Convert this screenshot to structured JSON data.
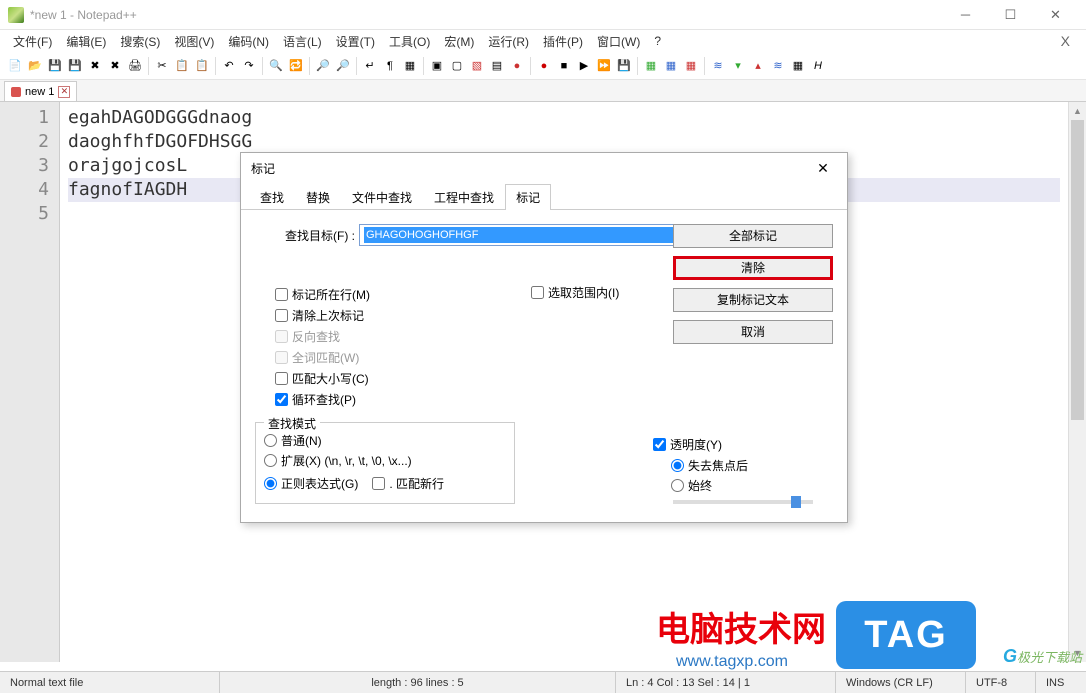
{
  "window": {
    "title": "*new 1 - Notepad++"
  },
  "menu": [
    "文件(F)",
    "编辑(E)",
    "搜索(S)",
    "视图(V)",
    "编码(N)",
    "语言(L)",
    "设置(T)",
    "工具(O)",
    "宏(M)",
    "运行(R)",
    "插件(P)",
    "窗口(W)",
    "?"
  ],
  "tab": {
    "name": "new 1"
  },
  "gutter": [
    "1",
    "2",
    "3",
    "4",
    "5"
  ],
  "code": {
    "l1": "egahDAGODGGGdnaog",
    "l2": "daoghfhfDGOFDHSGG",
    "l3": "orajgojcosL",
    "l4": "fagnofIAGDH"
  },
  "dialog": {
    "title": "标记",
    "tabs": [
      "查找",
      "替换",
      "文件中查找",
      "工程中查找",
      "标记"
    ],
    "search_label": "查找目标(F) :",
    "search_value": "GHAGOHOGHOFHGF",
    "buttons": {
      "mark_all": "全部标记",
      "clear": "清除",
      "copy": "复制标记文本",
      "cancel": "取消"
    },
    "checks": {
      "mark_line": "标记所在行(M)",
      "clear_prev": "清除上次标记",
      "backward": "反向查找",
      "whole_word": "全词匹配(W)",
      "match_case": "匹配大小写(C)",
      "wrap": "循环查找(P)",
      "in_selection": "选取范围内(I)"
    },
    "mode": {
      "legend": "查找模式",
      "normal": "普通(N)",
      "extended": "扩展(X) (\\n, \\r, \\t, \\0, \\x...)",
      "regex": "正则表达式(G)",
      "dotnl": ". 匹配新行"
    },
    "trans": {
      "label": "透明度(Y)",
      "onblur": "失去焦点后",
      "always": "始终"
    }
  },
  "status": {
    "filetype": "Normal text file",
    "length": "length : 96     lines : 5",
    "pos": "Ln : 4     Col : 13     Sel : 14 | 1",
    "eol": "Windows (CR LF)",
    "enc": "UTF-8",
    "ins": "INS"
  },
  "watermark": {
    "cn": "电脑技术网",
    "url": "www.tagxp.com",
    "tag": "TAG",
    "jg": "极光下载站"
  }
}
